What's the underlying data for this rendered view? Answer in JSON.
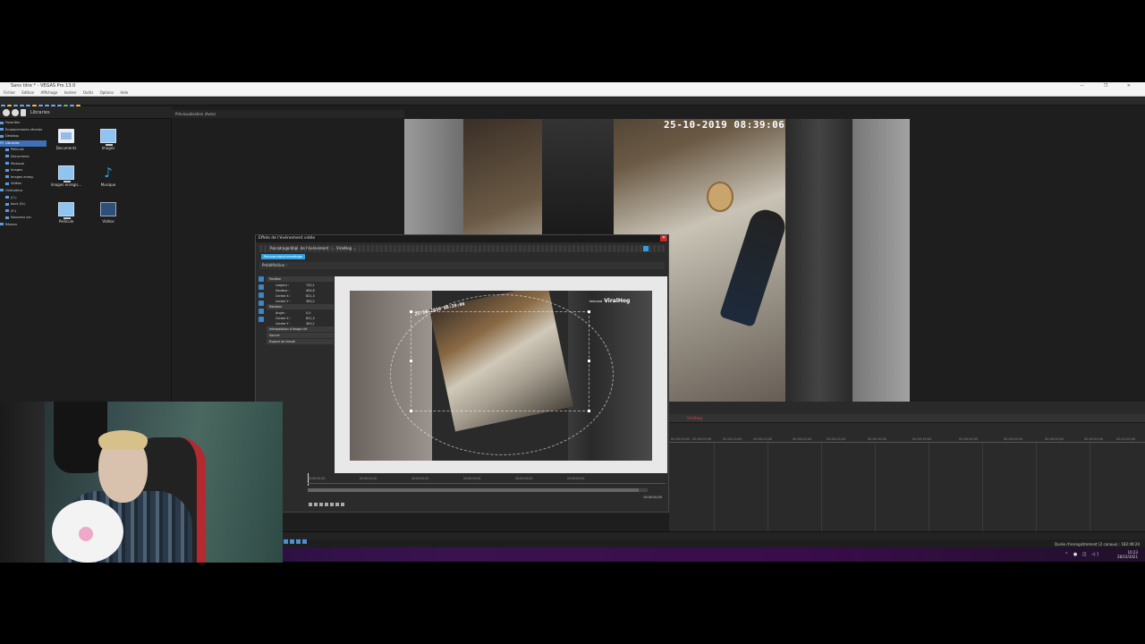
{
  "window": {
    "title": "Sans titre * - VEGAS Pro 13.0",
    "controls": "— ❐ ✕"
  },
  "menu": [
    "Fichier",
    "Edition",
    "Affichage",
    "Insérer",
    "Outils",
    "Options",
    "Aide"
  ],
  "explorer": {
    "library_label": "Libraries",
    "tree": [
      {
        "label": "Favorites",
        "selected": false
      },
      {
        "label": "Emplacements récents",
        "selected": false
      },
      {
        "label": "Desktop",
        "selected": false
      },
      {
        "label": "Libraries",
        "selected": true
      },
      {
        "label": "Pellicule",
        "selected": false
      },
      {
        "label": "Documents",
        "selected": false
      },
      {
        "label": "Musique",
        "selected": false
      },
      {
        "label": "Images",
        "selected": false
      },
      {
        "label": "Images enreg.",
        "selected": false
      },
      {
        "label": "Vidéos",
        "selected": false
      },
      {
        "label": "Ordinateur",
        "selected": false
      },
      {
        "label": "(C:)",
        "selected": false
      },
      {
        "label": "back (D:)",
        "selected": false
      },
      {
        "label": "(E:)",
        "selected": false
      },
      {
        "label": "Nouveau vol.",
        "selected": false
      },
      {
        "label": "Réseau",
        "selected": false
      }
    ],
    "files": [
      {
        "label": "Documents",
        "icon": "document-icon"
      },
      {
        "label": "Images",
        "icon": "monitor-icon"
      },
      {
        "label": "Images enregis...",
        "icon": "monitor-icon"
      },
      {
        "label": "Musique",
        "icon": "music-note-icon"
      },
      {
        "label": "Pellicule",
        "icon": "monitor-icon"
      },
      {
        "label": "Vidéos",
        "icon": "video-icon"
      }
    ]
  },
  "timeline_toolbar_label": "Prévisualisation (Auto)",
  "preview": {
    "timestamp": "25-10-2019 08:39:06"
  },
  "tracks": {
    "marker_label": "ViralHog",
    "ruler": [
      "00:00:00;00",
      "00:00:05;00",
      "00:00:10;00",
      "00:00:15;00",
      "00:00:20;00",
      "00:00:25;00",
      "00:00:30;00",
      "00:00:35;00",
      "00:00:40;00",
      "00:00:45;00",
      "00:00:50;00",
      "00:00:55;00",
      "00:01:00;00"
    ]
  },
  "status": {
    "text": "Durée d'enregistrement (2 canaux) : 182:49:20"
  },
  "taskbar": {
    "time": "10:23",
    "date": "28/10/2021",
    "tray_icons": "⌃ ● ◫ ◁)"
  },
  "dialog": {
    "title": "Effets de l'événement vidéo",
    "close": "✕",
    "chain_label": "Recadrage/dépl. de l'événement : ... ViralHog ...",
    "plugin_tag": "Panoramique/recadrage",
    "preset_label": "Prédéfinition :",
    "groups": [
      {
        "name": "Position",
        "rows": [
          {
            "k": "Largeur :",
            "v": "720,1"
          },
          {
            "k": "Hauteur :",
            "v": "404,8"
          },
          {
            "k": "Centre X :",
            "v": "621,3"
          },
          {
            "k": "Centre Y :",
            "v": "363,2"
          }
        ]
      },
      {
        "name": "Rotation",
        "rows": [
          {
            "k": "Angle :",
            "v": "0,0"
          },
          {
            "k": "Centre X :",
            "v": "621,3"
          },
          {
            "k": "Centre Y :",
            "v": "363,2"
          }
        ]
      },
      {
        "name": "Interpolation d'image clé",
        "rows": []
      },
      {
        "name": "Source",
        "rows": []
      },
      {
        "name": "Espace de travail",
        "rows": []
      }
    ],
    "logo_small": "kennard",
    "logo": "ViralHog",
    "canvas_timestamp": "25-10-2019 08:39:06",
    "ruler": [
      "00:00:00;00",
      "00:00:01;00",
      "00:00:02;00",
      "00:00:03;00",
      "00:00:04;00",
      "00:00:05;00"
    ],
    "timecode": "00:00:00;00"
  }
}
